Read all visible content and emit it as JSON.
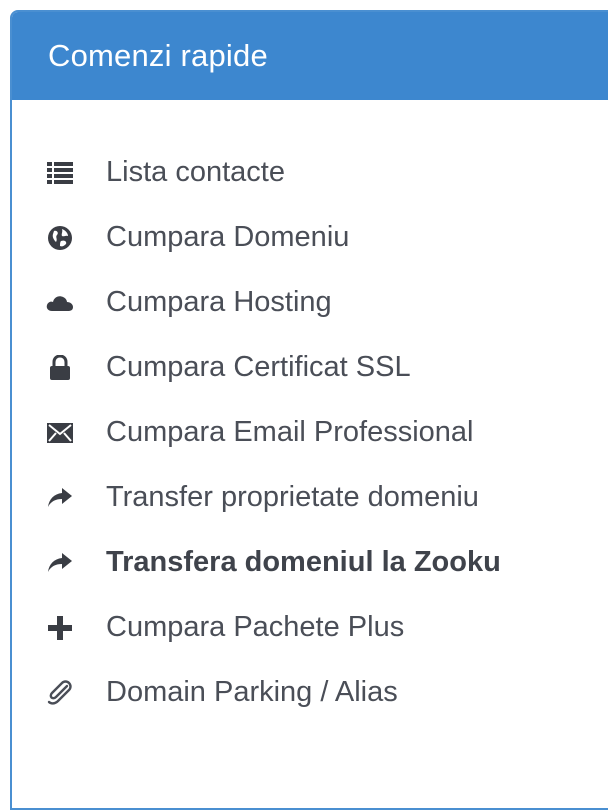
{
  "panel": {
    "title": "Comenzi rapide",
    "accent_color": "#3d87cf",
    "items": [
      {
        "label": "Lista contacte",
        "icon": "list-icon",
        "bold": false
      },
      {
        "label": "Cumpara Domeniu",
        "icon": "globe-icon",
        "bold": false
      },
      {
        "label": "Cumpara Hosting",
        "icon": "cloud-icon",
        "bold": false
      },
      {
        "label": "Cumpara Certificat SSL",
        "icon": "lock-icon",
        "bold": false
      },
      {
        "label": "Cumpara Email Professional",
        "icon": "envelope-icon",
        "bold": false
      },
      {
        "label": "Transfer proprietate domeniu",
        "icon": "share-arrow-icon",
        "bold": false
      },
      {
        "label": "Transfera domeniul la Zooku",
        "icon": "share-arrow-icon",
        "bold": true
      },
      {
        "label": "Cumpara Pachete Plus",
        "icon": "plus-icon",
        "bold": false
      },
      {
        "label": "Domain Parking / Alias",
        "icon": "paperclip-icon",
        "bold": false
      }
    ]
  }
}
